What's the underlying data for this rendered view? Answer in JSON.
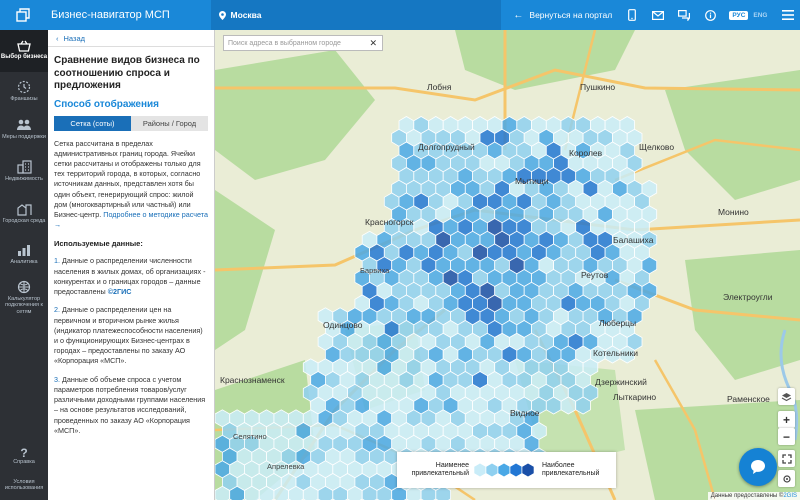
{
  "header": {
    "app_title": "Бизнес-навигатор МСП",
    "city": "Москва",
    "back_to_portal": "Вернуться на портал",
    "lang_ru": "РУС",
    "lang_en": "ENG",
    "accent": "#1a88d8"
  },
  "nav": {
    "items": [
      {
        "label": "Выбор бизнеса",
        "icon": "basket-icon",
        "active": true
      },
      {
        "label": "Франшизы",
        "icon": "franchise-icon"
      },
      {
        "label": "Меры поддержки",
        "icon": "support-icon"
      },
      {
        "label": "Недвижимость",
        "icon": "building-icon"
      },
      {
        "label": "Городская среда",
        "icon": "city-icon"
      },
      {
        "label": "Аналитика",
        "icon": "analytics-icon"
      },
      {
        "label": "Калькулятор подключения к сетям",
        "icon": "network-icon"
      }
    ],
    "help": "Справка",
    "terms": "Условия использования"
  },
  "panel": {
    "back": "Назад",
    "title": "Сравнение видов бизнеса по соотношению спроса и предложения",
    "display_mode": "Способ отображения",
    "tab_grid": "Сетка (соты)",
    "tab_regions": "Районы / Город",
    "description": "Сетка рассчитана в пределах административных границ города. Ячейки сетки рассчитаны и отображены только для тех территорий города, в которых, согласно источникам данных, представлен хотя бы один объект, генерирующий спрос: жилой дом (многоквартирный или частный) или Бизнес-центр.",
    "methodology_link": "Подробнее о методике расчета →",
    "sources_heading": "Используемые данные:",
    "source_1": "Данные о распределении численности населения в жилых домах, об организациях - конкурентах и о границах городов – данные предоставлены",
    "source_1_brand": "©2ГИС",
    "source_2": "Данные о распределении цен на первичном и вторичном рынке жилья (индикатор платежеспособности населения) и о функционирующих Бизнес-центрах в городах – предоставлены по заказу АО «Корпорация «МСП».",
    "source_3": "Данные об объеме спроса с учетом параметров потребления товаров/услуг различными доходными группами населения – на основе результатов исследований, проведенных по заказу АО «Корпорация «МСП»."
  },
  "map": {
    "search_placeholder": "Поиск адреса в выбранном городе",
    "places": [
      "Лобня",
      "Пушкино",
      "Долгопрудный",
      "Королев",
      "Щелково",
      "Мытищи",
      "Красногорск",
      "Балашиха",
      "Монино",
      "Реутов",
      "Барвиха",
      "Электроугли",
      "Люберцы",
      "Одинцово",
      "Краснознаменск",
      "Котельники",
      "Дзержинский",
      "Лыткарино",
      "Видное",
      "Раменское",
      "Апрелевка",
      "Селятино"
    ],
    "legend_low": "Наименее привлекательный",
    "legend_high": "Наиболее привлекательный",
    "legend_colors": [
      "#c9ecf8",
      "#8fd0f0",
      "#4aa8e6",
      "#2277d4",
      "#1a4fa8"
    ],
    "attribution_prefix": "Данные предоставлены ©",
    "attribution_brand": "2GIS"
  }
}
